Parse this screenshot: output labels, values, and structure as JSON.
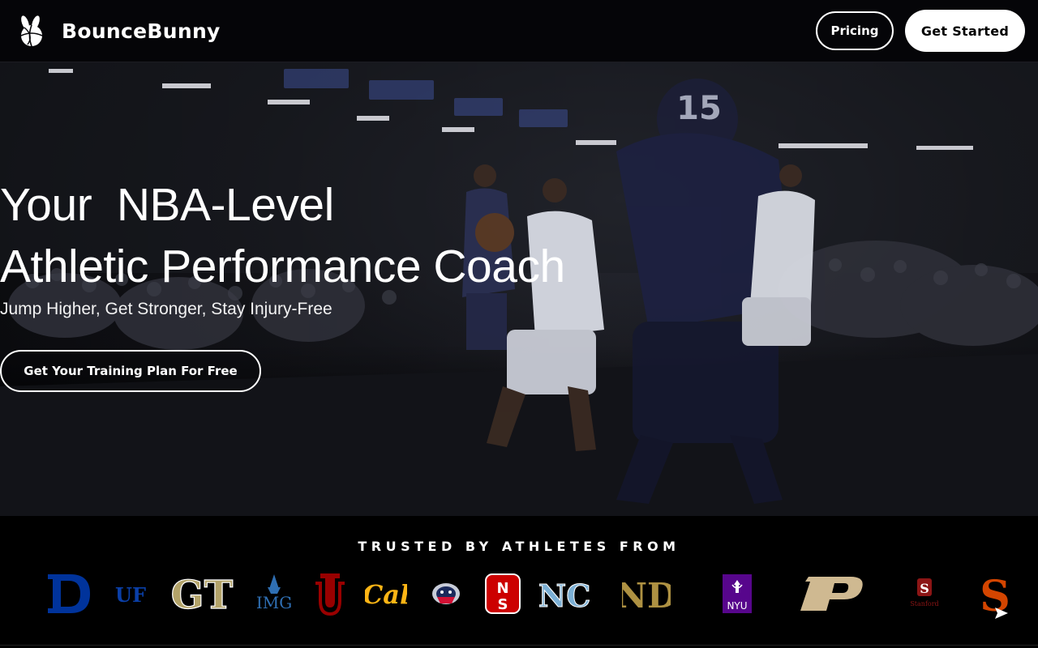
{
  "header": {
    "brand_name": "BounceBunny",
    "pricing_label": "Pricing",
    "get_started_label": "Get Started"
  },
  "hero": {
    "title_line1": "Your  NBA-Level",
    "title_line2": "Athletic Performance Coach",
    "subtitle": "Jump Higher, Get Stronger, Stay Injury-Free",
    "cta_label": "Get Your Training Plan For Free",
    "background_icon": "basketball-game-photo"
  },
  "trusted": {
    "label": "TRUSTED BY ATHLETES FROM",
    "logos": [
      {
        "name": "duke-logo",
        "text": "D"
      },
      {
        "name": "uf-logo",
        "text": "UF"
      },
      {
        "name": "georgia-tech-logo",
        "text": "GT"
      },
      {
        "name": "img-academy-logo",
        "text": "IMG"
      },
      {
        "name": "indiana-logo",
        "text": "IU"
      },
      {
        "name": "cal-logo",
        "text": "Cal"
      },
      {
        "name": "gonzaga-logo",
        "text": ""
      },
      {
        "name": "nc-state-logo",
        "text": "NCS"
      },
      {
        "name": "unc-logo",
        "text": "NC"
      },
      {
        "name": "notre-dame-logo",
        "text": "ND"
      },
      {
        "name": "nyu-logo",
        "text": "NYU"
      },
      {
        "name": "purdue-logo",
        "text": "P"
      },
      {
        "name": "stanford-logo",
        "text": "Stanford"
      },
      {
        "name": "syracuse-logo",
        "text": "S"
      }
    ]
  },
  "colors": {
    "duke": "#00339b",
    "uf": "#0a3fa8",
    "gt_gold": "#b3a369",
    "img": "#2f6fb3",
    "indiana": "#990000",
    "cal": "#fdb515",
    "ncstate": "#cc0000",
    "unc": "#7bafd4",
    "notre_dame": "#ae9142",
    "nyu": "#57068c",
    "purdue": "#cfb991",
    "stanford": "#8c1515",
    "syracuse": "#d44500"
  },
  "send_icon": "send-arrow-icon"
}
